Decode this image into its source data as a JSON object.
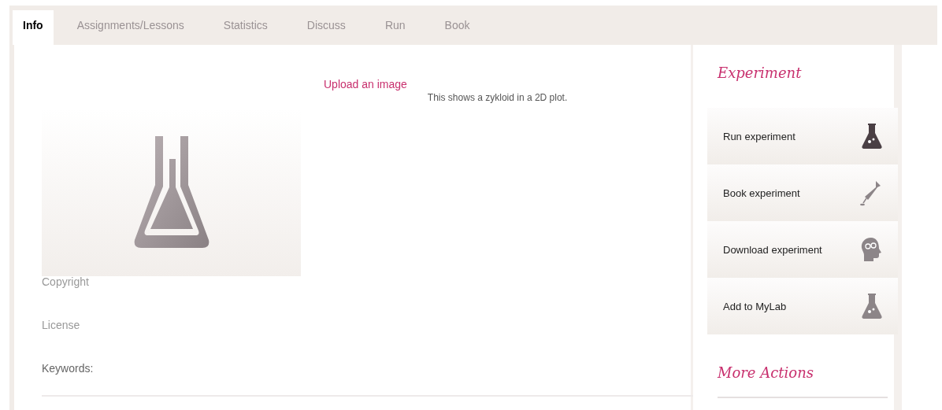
{
  "tabs": [
    {
      "label": "Info",
      "selected": true
    },
    {
      "label": "Assignments/Lessons",
      "selected": false
    },
    {
      "label": "Statistics",
      "selected": false
    },
    {
      "label": "Discuss",
      "selected": false
    },
    {
      "label": "Run",
      "selected": false
    },
    {
      "label": "Book",
      "selected": false
    }
  ],
  "upload_link": "Upload an image",
  "description": "This shows a zykloid in a 2D plot.",
  "fields": [
    "Copyright",
    "License",
    "Keywords:"
  ],
  "sidebar": {
    "heading": "Experiment",
    "actions": [
      {
        "label": "Run experiment",
        "kind": "flask"
      },
      {
        "label": "Book experiment",
        "kind": "dropper"
      },
      {
        "label": "Download experiment",
        "kind": "head"
      },
      {
        "label": "Add to MyLab",
        "kind": "flask-light"
      }
    ],
    "more_heading": "More Actions"
  }
}
